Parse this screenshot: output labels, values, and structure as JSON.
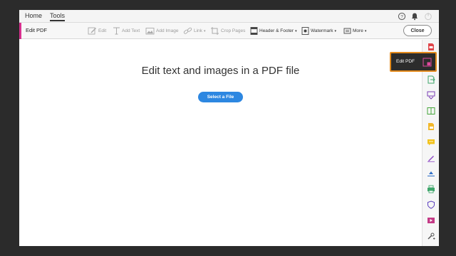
{
  "menu": {
    "tabs": [
      "Home",
      "Tools"
    ],
    "active_tab": "Tools"
  },
  "toolbar": {
    "title": "Edit PDF",
    "accent_color": "#d62f8d",
    "items": [
      "Edit",
      "Add Text",
      "Add Image",
      "Link",
      "Crop Pages",
      "Header & Footer",
      "Watermark",
      "More"
    ],
    "close_label": "Close"
  },
  "main": {
    "heading": "Edit text and images in a PDF file",
    "select_button": "Select a File"
  },
  "flyout": {
    "label": "Edit PDF",
    "border_color": "#e38a1c"
  },
  "rail": {
    "icons": [
      "create-pdf-icon",
      "edit-pdf-icon",
      "export-pdf-icon",
      "combine-files-icon",
      "organize-pages-icon",
      "scan-icon",
      "comment-icon",
      "fill-sign-icon",
      "send-for-signature-icon",
      "print-production-icon",
      "protect-icon",
      "rich-media-icon",
      "more-tools-icon"
    ]
  }
}
